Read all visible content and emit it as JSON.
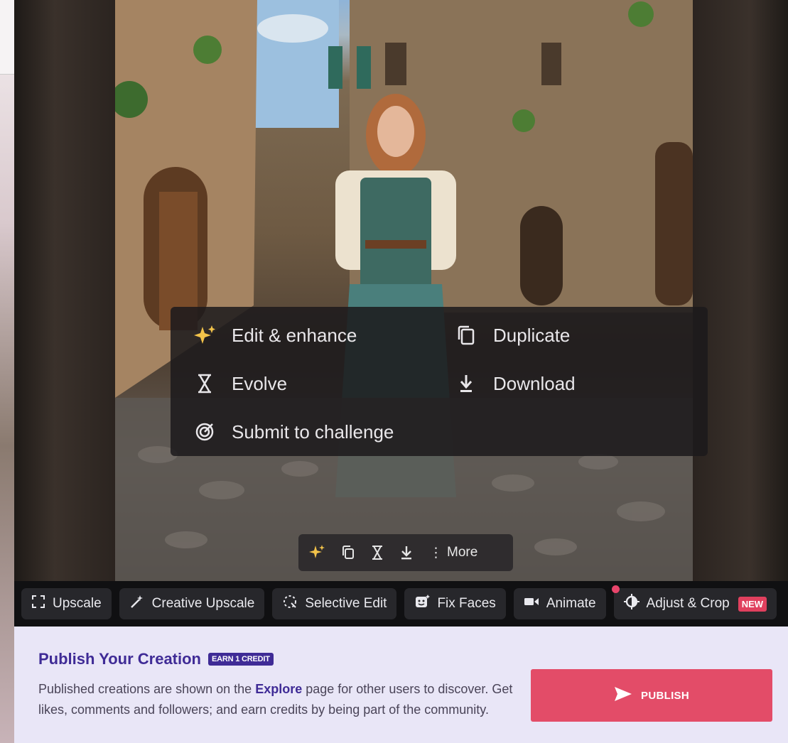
{
  "context_menu": {
    "edit_enhance": "Edit & enhance",
    "duplicate": "Duplicate",
    "evolve": "Evolve",
    "download": "Download",
    "submit_challenge": "Submit to challenge"
  },
  "mini_toolbar": {
    "more_label": "More"
  },
  "tools": {
    "upscale": "Upscale",
    "creative_upscale": "Creative Upscale",
    "selective_edit": "Selective Edit",
    "fix_faces": "Fix Faces",
    "animate": "Animate",
    "adjust_crop": "Adjust & Crop",
    "new_badge": "NEW"
  },
  "publish": {
    "title": "Publish Your Creation",
    "earn_badge": "EARN 1 CREDIT",
    "desc_before": "Published creations are shown on the ",
    "desc_link": "Explore",
    "desc_after": " page for other users to discover. Get likes, comments and followers; and earn credits by being part of the community.",
    "button_label": "PUBLISH"
  },
  "colors": {
    "accent": "#e34c68",
    "brand_purple": "#3f2b96",
    "panel_bg": "#e9e6f7",
    "toolbar_bg": "#101012"
  }
}
